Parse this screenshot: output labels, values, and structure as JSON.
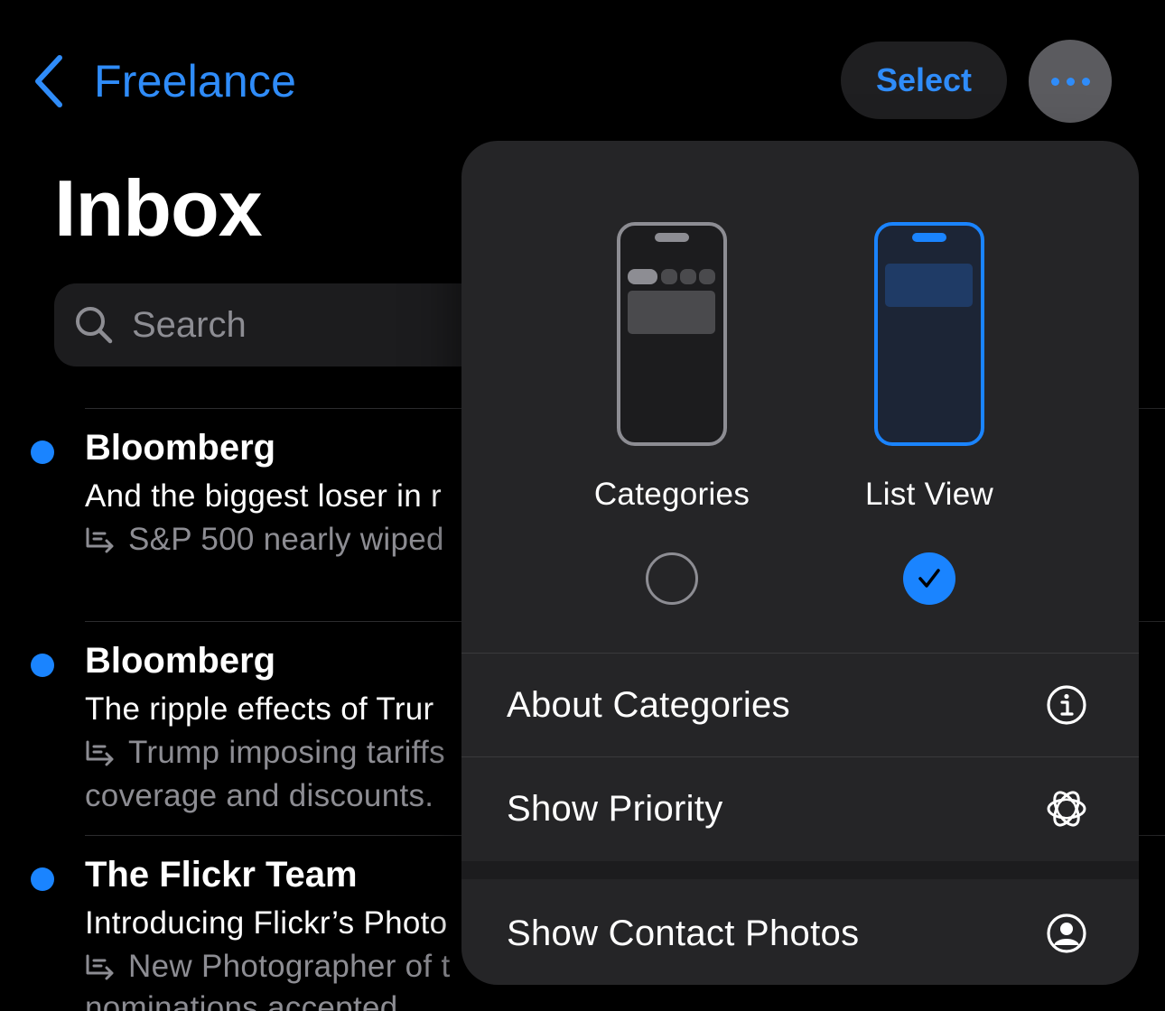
{
  "nav": {
    "back_label": "Freelance",
    "select_label": "Select",
    "more_icon": "ellipsis-icon",
    "accent": "#2f8cf9"
  },
  "title": "Inbox",
  "search": {
    "placeholder": "Search"
  },
  "messages": [
    {
      "sender": "Bloomberg",
      "subject": "And the biggest loser in r",
      "preview": "S&P 500 nearly wiped",
      "preview2": "",
      "unread": true
    },
    {
      "sender": "Bloomberg",
      "subject": "The ripple effects of Trur",
      "preview": "Trump imposing tariffs",
      "preview2": "coverage and discounts.",
      "unread": true
    },
    {
      "sender": "The Flickr Team",
      "subject": "Introducing Flickr’s Photo",
      "preview": "New Photographer of t",
      "preview2": "nominations accepted",
      "unread": true
    }
  ],
  "menu": {
    "views": [
      {
        "label": "Categories",
        "selected": false
      },
      {
        "label": "List View",
        "selected": true
      }
    ],
    "items": [
      {
        "label": "About Categories",
        "icon": "info-circle-icon"
      },
      {
        "label": "Show Priority",
        "icon": "priority-sparkle-icon"
      },
      {
        "label": "Show Contact Photos",
        "icon": "person-circle-icon"
      }
    ]
  }
}
